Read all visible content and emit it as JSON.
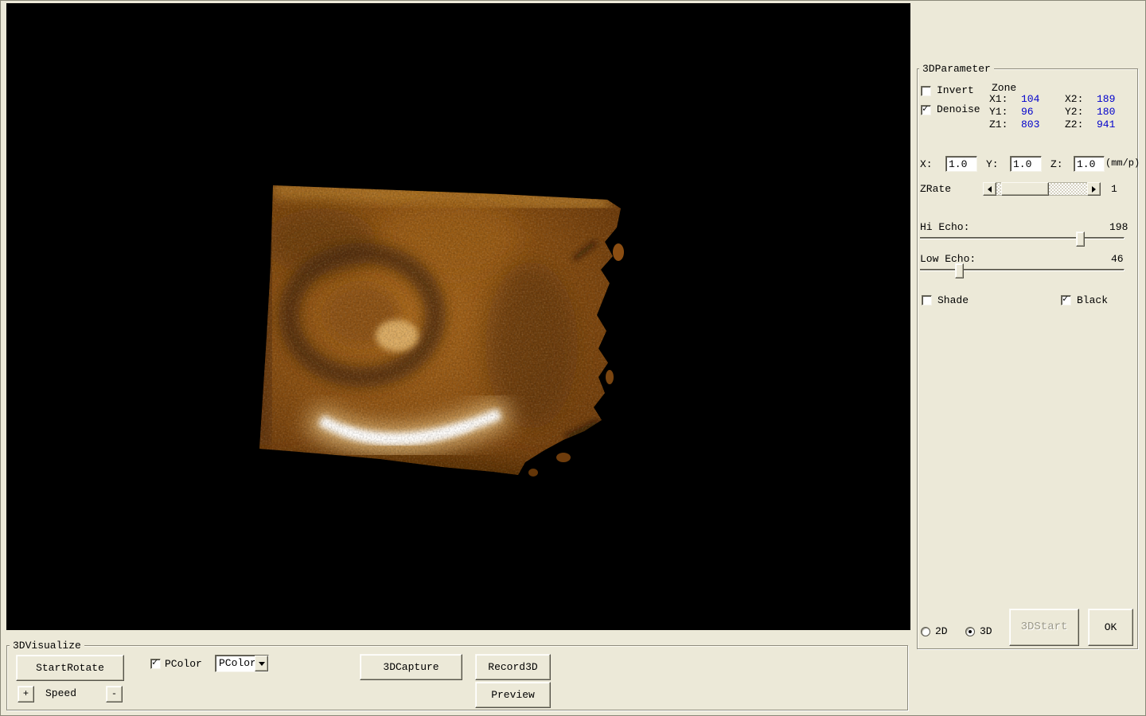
{
  "right_panel": {
    "group_title": "3DParameter",
    "invert_label": "Invert",
    "denoise_label": "Denoise",
    "zone": {
      "title": "Zone",
      "x1_label": "X1:",
      "x1": "104",
      "x2_label": "X2:",
      "x2": "189",
      "y1_label": "Y1:",
      "y1": "96",
      "y2_label": "Y2:",
      "y2": "180",
      "z1_label": "Z1:",
      "z1": "803",
      "z2_label": "Z2:",
      "z2": "941"
    },
    "scale": {
      "x_label": "X:",
      "x": "1.0",
      "y_label": "Y:",
      "y": "1.0",
      "z_label": "Z:",
      "z": "1.0",
      "unit": "(mm/p)"
    },
    "zrate_label": "ZRate",
    "zrate_value": "1",
    "hi_echo_label": "Hi Echo:",
    "hi_echo_value": "198",
    "low_echo_label": "Low Echo:",
    "low_echo_value": "46",
    "shade_label": "Shade",
    "black_label": "Black",
    "radio_2d_label": "2D",
    "radio_3d_label": "3D",
    "start3d_button": "3DStart",
    "ok_button": "OK"
  },
  "bottom_panel": {
    "group_title": "3DVisualize",
    "start_rotate_button": "StartRotate",
    "pcolor_label": "PColor",
    "pcolor_selected": "PColor",
    "capture3d_button": "3DCapture",
    "record3d_button": "Record3D",
    "preview_button": "Preview",
    "plus_button": "+",
    "speed_label": "Speed",
    "minus_button": "-"
  },
  "colors": {
    "dialog_bg": "#ece9d8",
    "viewport_bg": "#000000",
    "value_blue": "#0000cc",
    "volume_brown": "#8d5213"
  }
}
